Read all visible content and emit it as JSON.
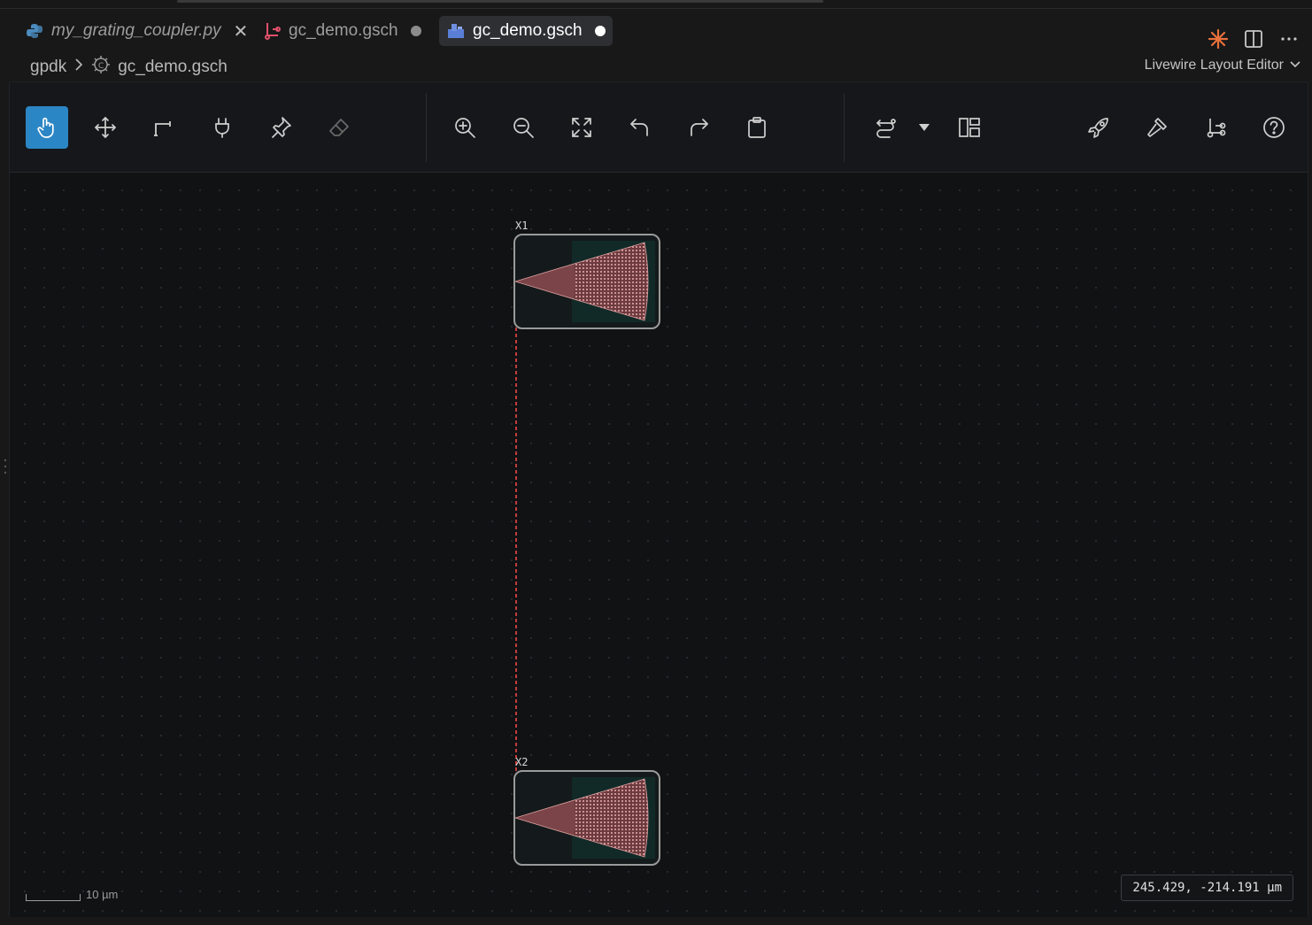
{
  "tabs": [
    {
      "label": "my_grating_coupler.py",
      "icon": "python-file-icon",
      "state": "close",
      "italic": true
    },
    {
      "label": "gc_demo.gsch",
      "icon": "schematic-route-icon",
      "state": "modified"
    },
    {
      "label": "gc_demo.gsch",
      "icon": "layout-component-icon",
      "state": "modified",
      "active": true
    }
  ],
  "breadcrumb": {
    "root": "gpdk",
    "file": "gc_demo.gsch"
  },
  "editor_name": "Livewire Layout Editor",
  "toolbar": {
    "group1": [
      "select-tool",
      "move-tool",
      "route-tool",
      "port-tool",
      "pin-tool",
      "eraser-tool"
    ],
    "group2": [
      "zoom-in",
      "zoom-out",
      "fit-view",
      "undo",
      "redo",
      "clipboard"
    ],
    "group3": [
      "auto-route",
      "layout-grid"
    ],
    "group4": [
      "launch",
      "build",
      "branch",
      "help"
    ]
  },
  "cells": [
    {
      "label": "X1"
    },
    {
      "label": "X2"
    }
  ],
  "scale_bar": "10 µm",
  "cursor_coords": "245.429, -214.191 µm",
  "colors": {
    "accent": "#2b86c5",
    "wire": "#d04848",
    "grating": "#c87878"
  }
}
